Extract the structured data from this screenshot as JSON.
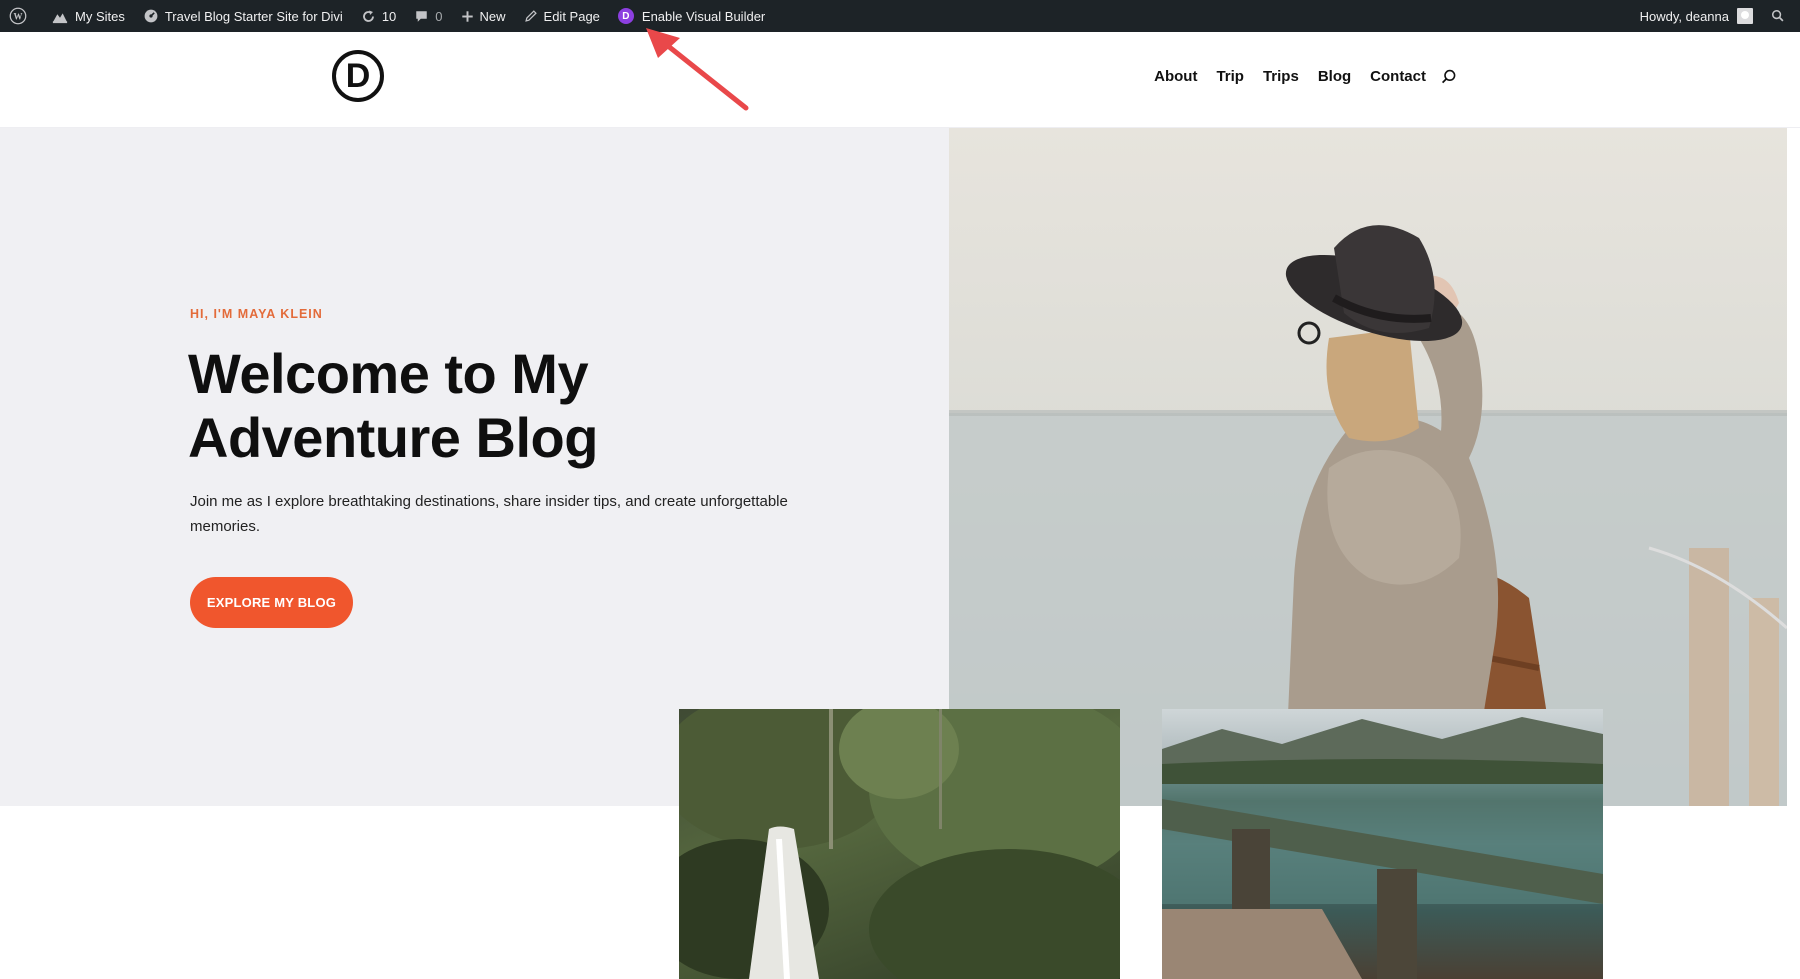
{
  "admin_bar": {
    "my_sites": "My Sites",
    "site_name": "Travel Blog Starter Site for Divi",
    "updates_count": "10",
    "comments_count": "0",
    "new_label": "New",
    "edit_page": "Edit Page",
    "visual_builder": "Enable Visual Builder",
    "howdy": "Howdy, deanna"
  },
  "header": {
    "logo_letter": "D",
    "nav": [
      "About",
      "Trip",
      "Trips",
      "Blog",
      "Contact"
    ]
  },
  "hero": {
    "eyebrow": "HI, I'M MAYA KLEIN",
    "title": "Welcome to My Adventure Blog",
    "text": "Join me as I explore breathtaking destinations, share insider tips, and create unforgettable memories.",
    "cta": "EXPLORE MY BLOG"
  },
  "colors": {
    "accent": "#f0562d",
    "eyebrow": "#e36b3a",
    "admin_bar": "#1d2327",
    "hero_bg": "#f0f0f3",
    "arrow": "#e9484a"
  },
  "icons": [
    "wordpress-icon",
    "my-sites-icon",
    "dashboard-icon",
    "updates-icon",
    "comments-icon",
    "plus-icon",
    "pencil-icon",
    "divi-icon",
    "search-icon"
  ]
}
